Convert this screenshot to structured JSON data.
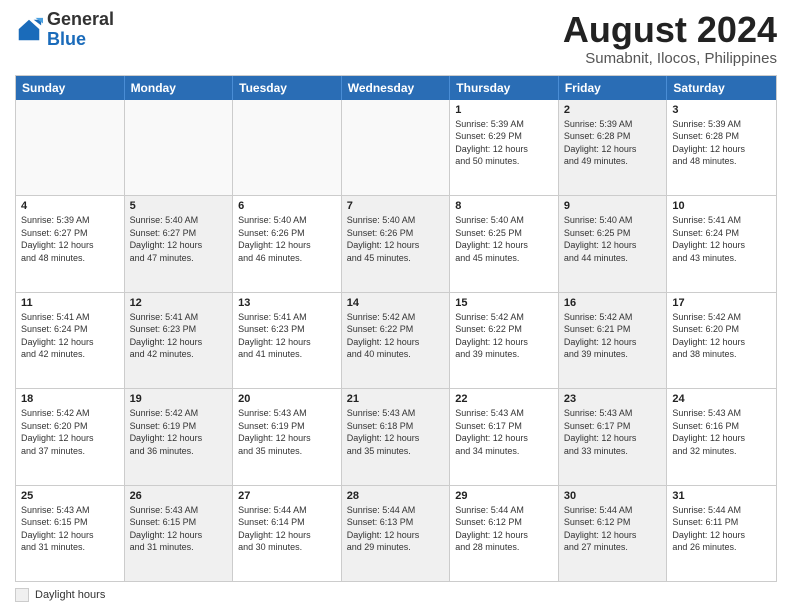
{
  "header": {
    "logo_general": "General",
    "logo_blue": "Blue",
    "month_title": "August 2024",
    "subtitle": "Sumabnit, Ilocos, Philippines"
  },
  "calendar": {
    "days_of_week": [
      "Sunday",
      "Monday",
      "Tuesday",
      "Wednesday",
      "Thursday",
      "Friday",
      "Saturday"
    ],
    "weeks": [
      [
        {
          "date": "",
          "info": "",
          "empty": true
        },
        {
          "date": "",
          "info": "",
          "empty": true
        },
        {
          "date": "",
          "info": "",
          "empty": true
        },
        {
          "date": "",
          "info": "",
          "empty": true
        },
        {
          "date": "1",
          "info": "Sunrise: 5:39 AM\nSunset: 6:29 PM\nDaylight: 12 hours\nand 50 minutes.",
          "shaded": false
        },
        {
          "date": "2",
          "info": "Sunrise: 5:39 AM\nSunset: 6:28 PM\nDaylight: 12 hours\nand 49 minutes.",
          "shaded": true
        },
        {
          "date": "3",
          "info": "Sunrise: 5:39 AM\nSunset: 6:28 PM\nDaylight: 12 hours\nand 48 minutes.",
          "shaded": false
        }
      ],
      [
        {
          "date": "4",
          "info": "Sunrise: 5:39 AM\nSunset: 6:27 PM\nDaylight: 12 hours\nand 48 minutes.",
          "shaded": false
        },
        {
          "date": "5",
          "info": "Sunrise: 5:40 AM\nSunset: 6:27 PM\nDaylight: 12 hours\nand 47 minutes.",
          "shaded": true
        },
        {
          "date": "6",
          "info": "Sunrise: 5:40 AM\nSunset: 6:26 PM\nDaylight: 12 hours\nand 46 minutes.",
          "shaded": false
        },
        {
          "date": "7",
          "info": "Sunrise: 5:40 AM\nSunset: 6:26 PM\nDaylight: 12 hours\nand 45 minutes.",
          "shaded": true
        },
        {
          "date": "8",
          "info": "Sunrise: 5:40 AM\nSunset: 6:25 PM\nDaylight: 12 hours\nand 45 minutes.",
          "shaded": false
        },
        {
          "date": "9",
          "info": "Sunrise: 5:40 AM\nSunset: 6:25 PM\nDaylight: 12 hours\nand 44 minutes.",
          "shaded": true
        },
        {
          "date": "10",
          "info": "Sunrise: 5:41 AM\nSunset: 6:24 PM\nDaylight: 12 hours\nand 43 minutes.",
          "shaded": false
        }
      ],
      [
        {
          "date": "11",
          "info": "Sunrise: 5:41 AM\nSunset: 6:24 PM\nDaylight: 12 hours\nand 42 minutes.",
          "shaded": false
        },
        {
          "date": "12",
          "info": "Sunrise: 5:41 AM\nSunset: 6:23 PM\nDaylight: 12 hours\nand 42 minutes.",
          "shaded": true
        },
        {
          "date": "13",
          "info": "Sunrise: 5:41 AM\nSunset: 6:23 PM\nDaylight: 12 hours\nand 41 minutes.",
          "shaded": false
        },
        {
          "date": "14",
          "info": "Sunrise: 5:42 AM\nSunset: 6:22 PM\nDaylight: 12 hours\nand 40 minutes.",
          "shaded": true
        },
        {
          "date": "15",
          "info": "Sunrise: 5:42 AM\nSunset: 6:22 PM\nDaylight: 12 hours\nand 39 minutes.",
          "shaded": false
        },
        {
          "date": "16",
          "info": "Sunrise: 5:42 AM\nSunset: 6:21 PM\nDaylight: 12 hours\nand 39 minutes.",
          "shaded": true
        },
        {
          "date": "17",
          "info": "Sunrise: 5:42 AM\nSunset: 6:20 PM\nDaylight: 12 hours\nand 38 minutes.",
          "shaded": false
        }
      ],
      [
        {
          "date": "18",
          "info": "Sunrise: 5:42 AM\nSunset: 6:20 PM\nDaylight: 12 hours\nand 37 minutes.",
          "shaded": false
        },
        {
          "date": "19",
          "info": "Sunrise: 5:42 AM\nSunset: 6:19 PM\nDaylight: 12 hours\nand 36 minutes.",
          "shaded": true
        },
        {
          "date": "20",
          "info": "Sunrise: 5:43 AM\nSunset: 6:19 PM\nDaylight: 12 hours\nand 35 minutes.",
          "shaded": false
        },
        {
          "date": "21",
          "info": "Sunrise: 5:43 AM\nSunset: 6:18 PM\nDaylight: 12 hours\nand 35 minutes.",
          "shaded": true
        },
        {
          "date": "22",
          "info": "Sunrise: 5:43 AM\nSunset: 6:17 PM\nDaylight: 12 hours\nand 34 minutes.",
          "shaded": false
        },
        {
          "date": "23",
          "info": "Sunrise: 5:43 AM\nSunset: 6:17 PM\nDaylight: 12 hours\nand 33 minutes.",
          "shaded": true
        },
        {
          "date": "24",
          "info": "Sunrise: 5:43 AM\nSunset: 6:16 PM\nDaylight: 12 hours\nand 32 minutes.",
          "shaded": false
        }
      ],
      [
        {
          "date": "25",
          "info": "Sunrise: 5:43 AM\nSunset: 6:15 PM\nDaylight: 12 hours\nand 31 minutes.",
          "shaded": false
        },
        {
          "date": "26",
          "info": "Sunrise: 5:43 AM\nSunset: 6:15 PM\nDaylight: 12 hours\nand 31 minutes.",
          "shaded": true
        },
        {
          "date": "27",
          "info": "Sunrise: 5:44 AM\nSunset: 6:14 PM\nDaylight: 12 hours\nand 30 minutes.",
          "shaded": false
        },
        {
          "date": "28",
          "info": "Sunrise: 5:44 AM\nSunset: 6:13 PM\nDaylight: 12 hours\nand 29 minutes.",
          "shaded": true
        },
        {
          "date": "29",
          "info": "Sunrise: 5:44 AM\nSunset: 6:12 PM\nDaylight: 12 hours\nand 28 minutes.",
          "shaded": false
        },
        {
          "date": "30",
          "info": "Sunrise: 5:44 AM\nSunset: 6:12 PM\nDaylight: 12 hours\nand 27 minutes.",
          "shaded": true
        },
        {
          "date": "31",
          "info": "Sunrise: 5:44 AM\nSunset: 6:11 PM\nDaylight: 12 hours\nand 26 minutes.",
          "shaded": false
        }
      ]
    ]
  },
  "footer": {
    "shaded_label": "Daylight hours"
  }
}
